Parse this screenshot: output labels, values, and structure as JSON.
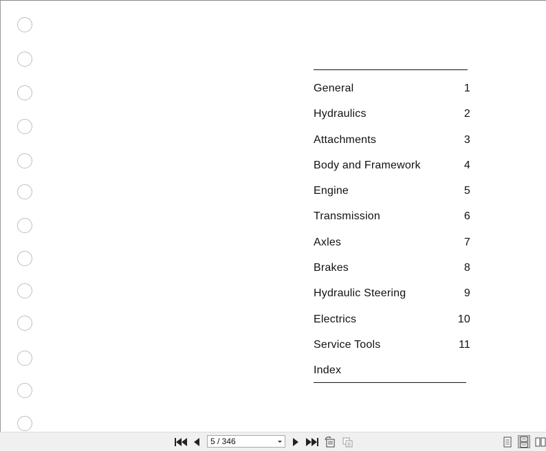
{
  "toc": {
    "items": [
      {
        "label": "General",
        "num": "1"
      },
      {
        "label": "Hydraulics",
        "num": "2"
      },
      {
        "label": "Attachments",
        "num": "3"
      },
      {
        "label": "Body and Framework",
        "num": "4"
      },
      {
        "label": "Engine",
        "num": "5"
      },
      {
        "label": "Transmission",
        "num": "6"
      },
      {
        "label": "Axles",
        "num": "7"
      },
      {
        "label": "Brakes",
        "num": "8"
      },
      {
        "label": "Hydraulic Steering",
        "num": "9"
      },
      {
        "label": "Electrics",
        "num": "10"
      },
      {
        "label": "Service Tools",
        "num": "11"
      },
      {
        "label": "Index",
        "num": ""
      }
    ]
  },
  "toolbar": {
    "page_indicator": "5 / 346",
    "icons": [
      "first-page-icon",
      "previous-page-icon",
      "next-page-icon",
      "last-page-icon",
      "rotate-icon",
      "fit-icon",
      "single-page-view-icon",
      "continuous-view-icon",
      "two-page-view-icon"
    ]
  }
}
